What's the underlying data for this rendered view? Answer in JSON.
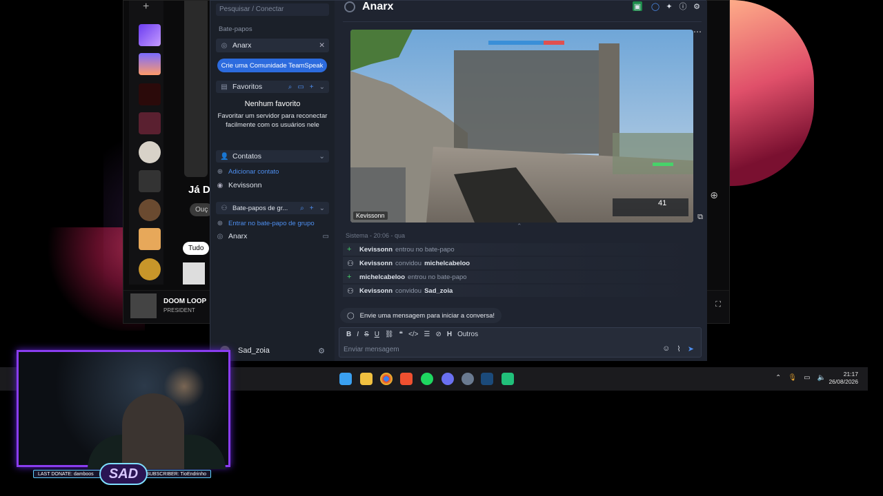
{
  "music_app": {
    "artist_heading": "Já D",
    "follow_label": "Ouç",
    "filter_chip": "Tudo",
    "now_playing": {
      "title": "DOOM LOOP",
      "artist": "PRESIDENT"
    }
  },
  "sidebar": {
    "search_placeholder": "Pesquisar / Conectar",
    "section_chats": "Bate-papos",
    "active_chat": "Anarx",
    "create_community_btn": "Crie uma Comunidade TeamSpeak",
    "favorites_header": "Favoritos",
    "favorites_empty_title": "Nenhum favorito",
    "favorites_empty_desc": "Favoritar um servidor para reconectar facilmente com os usuários nele",
    "contacts_header": "Contatos",
    "add_contact": "Adicionar contato",
    "contact_name": "Kevissonn",
    "group_chats_header": "Bate-papos de gr...",
    "join_group_chat": "Entrar no bate-papo de grupo",
    "group_chat_name": "Anarx",
    "current_user": "Sad_zoia"
  },
  "chat": {
    "title": "Anarx",
    "video_label": "Kevissonn",
    "system_header": "Sistema - 20:06 - qua",
    "messages": [
      {
        "user": "Kevissonn",
        "text": "entrou no bate-papo",
        "icon": "plus-icon"
      },
      {
        "user": "Kevissonn",
        "text": "convidou",
        "target": "michelcabeloo",
        "icon": "invite-icon"
      },
      {
        "user": "michelcabeloo",
        "text": "entrou no bate-papo",
        "icon": "plus-icon"
      },
      {
        "user": "Kevissonn",
        "text": "convidou",
        "target": "Sad_zoia",
        "icon": "invite-icon"
      }
    ],
    "hint": "Envie uma mensagem para iniciar a conversa!",
    "toolbar_more": "Outros",
    "input_placeholder": "Enviar mensagem",
    "hud_ammo": "41"
  },
  "taskbar": {
    "time": "21:17",
    "date": "26/08/2026"
  },
  "overlay": {
    "last_donate_label": "LAST DONATE:",
    "last_donate_name": "damboos",
    "subscriber_label": "SUBSCRIBER:",
    "subscriber_name": "TioEndrinho",
    "logo_text": "SAD"
  },
  "colors": {
    "accent": "#2c6bde",
    "panel": "#1f2430",
    "sidebar": "#1b2029",
    "overlay_border": "#8a3df0"
  }
}
